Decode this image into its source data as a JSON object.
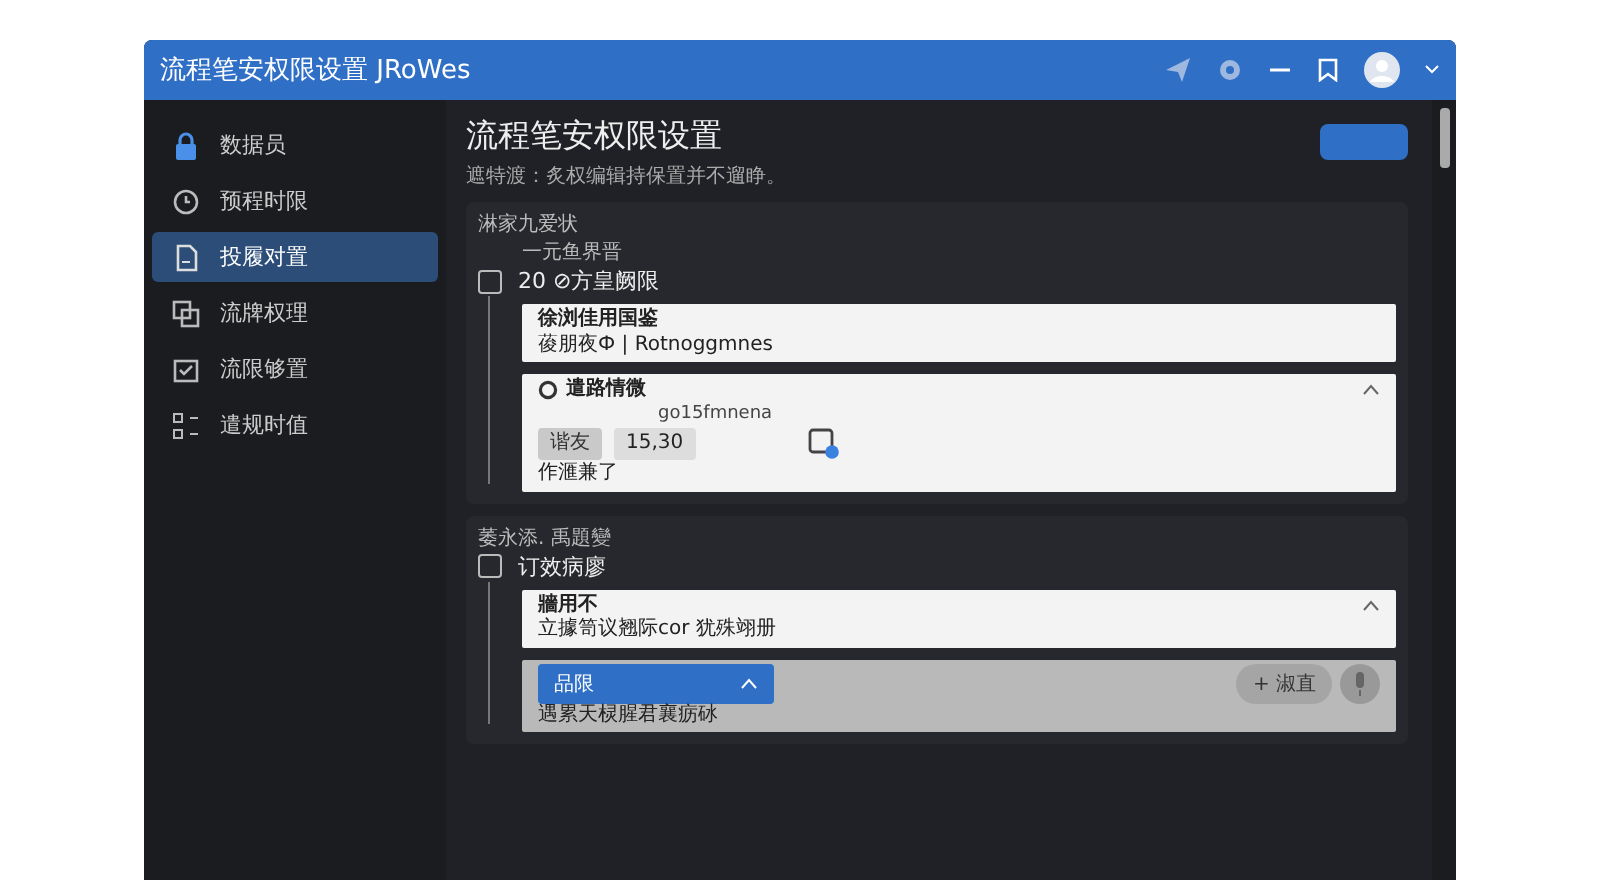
{
  "window": {
    "title": "流程笔安权限设置 JRoWes"
  },
  "sidebar": {
    "items": [
      {
        "label": "数据员",
        "selected": false
      },
      {
        "label": "预程时限",
        "selected": false
      },
      {
        "label": "投履对置",
        "selected": true
      },
      {
        "label": "流牌权理",
        "selected": false
      },
      {
        "label": "流限够置",
        "selected": false
      },
      {
        "label": "遣规时值",
        "selected": false
      }
    ]
  },
  "page": {
    "heading": "流程笔安权限设置",
    "subtitle": "遮特渡：炙权编辑持保置并不遛睁。"
  },
  "sections": [
    {
      "label": "淋家九爱状",
      "sublabel": "一元鱼界晋",
      "title": "20 ⊘方皇阙限",
      "checked": false,
      "cards": [
        {
          "kind": "info",
          "title": "徐浏佳用国鉴",
          "text": "葰朋夜Ф | Rotnoggmnes"
        },
        {
          "kind": "detail",
          "title": "遣路情微",
          "expanded": true,
          "note": "go15fmnena",
          "tag": "谐友",
          "value": "15,30",
          "footer": "作滙兼了"
        }
      ]
    },
    {
      "label": "萎永添. 禹題變",
      "title": "订效病廖",
      "checked": false,
      "cards": [
        {
          "kind": "info",
          "title": "牆用不",
          "text": "立據笥议翘际cor 犹殊翊册",
          "expanded": true
        },
        {
          "kind": "select",
          "select": "品限",
          "text": "遇累天棂腥君襄疬砅",
          "button": "+ 淑直"
        }
      ]
    }
  ]
}
